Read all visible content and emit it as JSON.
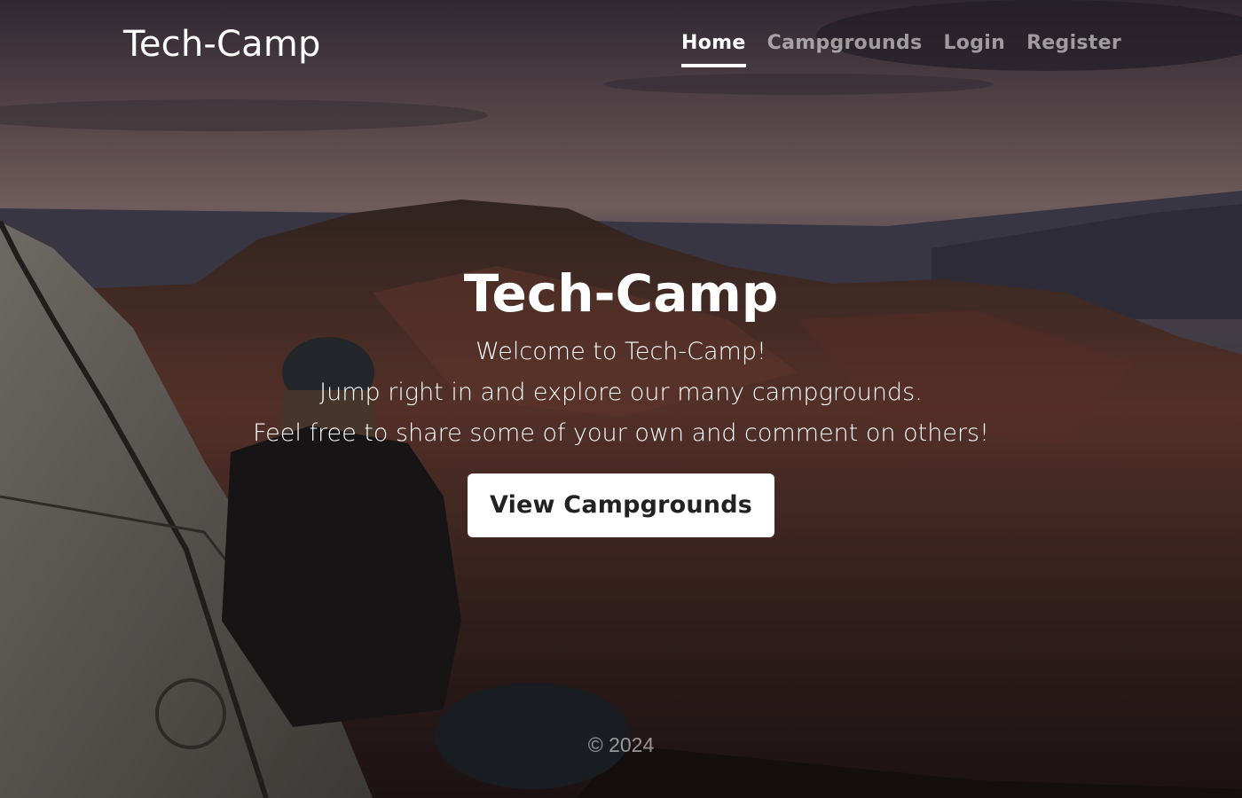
{
  "navbar": {
    "brand": "Tech-Camp",
    "links": [
      {
        "label": "Home",
        "active": true
      },
      {
        "label": "Campgrounds",
        "active": false
      },
      {
        "label": "Login",
        "active": false
      },
      {
        "label": "Register",
        "active": false
      }
    ]
  },
  "hero": {
    "title": "Tech-Camp",
    "lines": [
      "Welcome to Tech-Camp!",
      "Jump right in and explore our many campgrounds.",
      "Feel free to share some of your own and comment on others!"
    ],
    "cta_label": "View Campgrounds"
  },
  "footer": {
    "copyright": "© 2024"
  }
}
